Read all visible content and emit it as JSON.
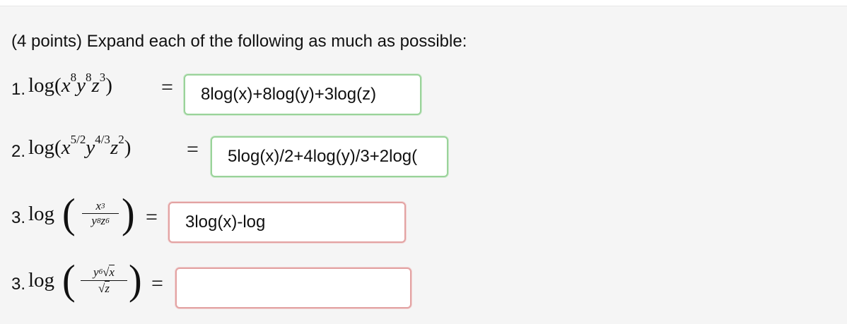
{
  "prompt": "(4 points) Expand each of the following as much as possible:",
  "items": [
    {
      "number": "1.",
      "answer": "8log(x)+8log(y)+3log(z)",
      "status": "correct"
    },
    {
      "number": "2.",
      "answer": "5log(x)/2+4log(y)/3+2log(",
      "status": "correct"
    },
    {
      "number": "3.",
      "answer": "3log(x)-log",
      "status": "incorrect"
    },
    {
      "number": "3.",
      "answer": "",
      "status": "incorrect"
    }
  ],
  "colors": {
    "correct": "#9ad39a",
    "incorrect": "#e3a3a3",
    "panel": "#f5f5f5"
  }
}
